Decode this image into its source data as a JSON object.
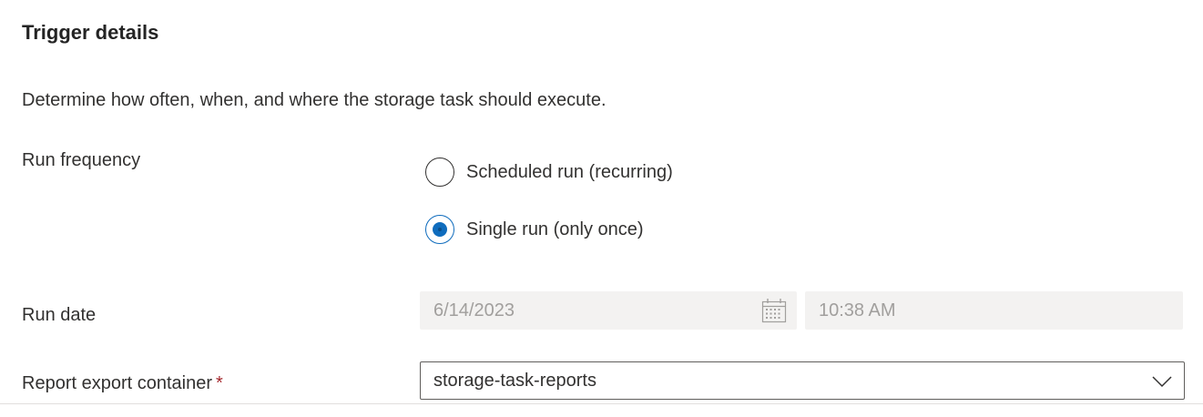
{
  "section": {
    "title": "Trigger details",
    "description": "Determine how often, when, and where the storage task should execute."
  },
  "run_frequency": {
    "label": "Run frequency",
    "options": [
      {
        "label": "Scheduled run (recurring)",
        "selected": false
      },
      {
        "label": "Single run (only once)",
        "selected": true
      }
    ]
  },
  "run_date": {
    "label": "Run date",
    "date_value": "6/14/2023",
    "time_value": "10:38 AM",
    "calendar_icon": "calendar-icon"
  },
  "report_export": {
    "label": "Report export container",
    "required_mark": "*",
    "selected_value": "storage-task-reports",
    "dropdown_icon": "chevron-down-icon"
  },
  "colors": {
    "accent": "#0f6cbd",
    "required": "#a4262c",
    "disabled_bg": "#f3f2f1",
    "disabled_text": "#a19f9d"
  }
}
